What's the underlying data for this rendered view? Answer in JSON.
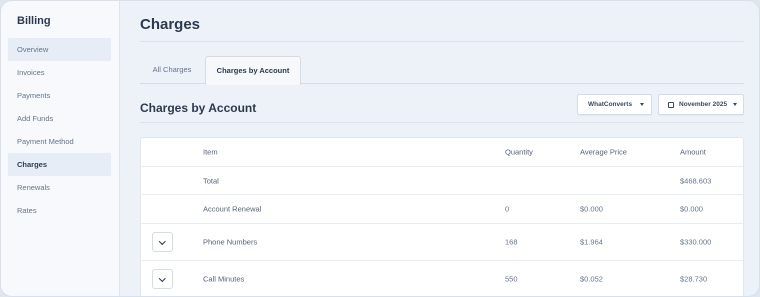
{
  "sidebar": {
    "title": "Billing",
    "items": [
      {
        "label": "Overview"
      },
      {
        "label": "Invoices"
      },
      {
        "label": "Payments"
      },
      {
        "label": "Add Funds"
      },
      {
        "label": "Payment Method"
      },
      {
        "label": "Charges"
      },
      {
        "label": "Renewals"
      },
      {
        "label": "Rates"
      }
    ]
  },
  "page": {
    "title": "Charges",
    "tabs": [
      {
        "label": "All Charges"
      },
      {
        "label": "Charges by Account"
      }
    ],
    "section_title": "Charges by Account",
    "account_filter": "WhatConverts",
    "date_filter": "November 2025"
  },
  "table": {
    "headers": {
      "item": "Item",
      "quantity": "Quantity",
      "average_price": "Average Price",
      "amount": "Amount"
    },
    "rows": [
      {
        "item": "Total",
        "quantity": "",
        "average_price": "",
        "amount": "$468.603"
      },
      {
        "item": "Account Renewal",
        "quantity": "0",
        "average_price": "$0.000",
        "amount": "$0.000"
      },
      {
        "item": "Phone Numbers",
        "quantity": "168",
        "average_price": "$1.964",
        "amount": "$330.000"
      },
      {
        "item": "Call Minutes",
        "quantity": "550",
        "average_price": "$0.052",
        "amount": "$28.730"
      }
    ]
  },
  "icons": {
    "expand": "chevron-down-icon",
    "caret": "caret-down-icon",
    "calendar": "calendar-icon"
  }
}
